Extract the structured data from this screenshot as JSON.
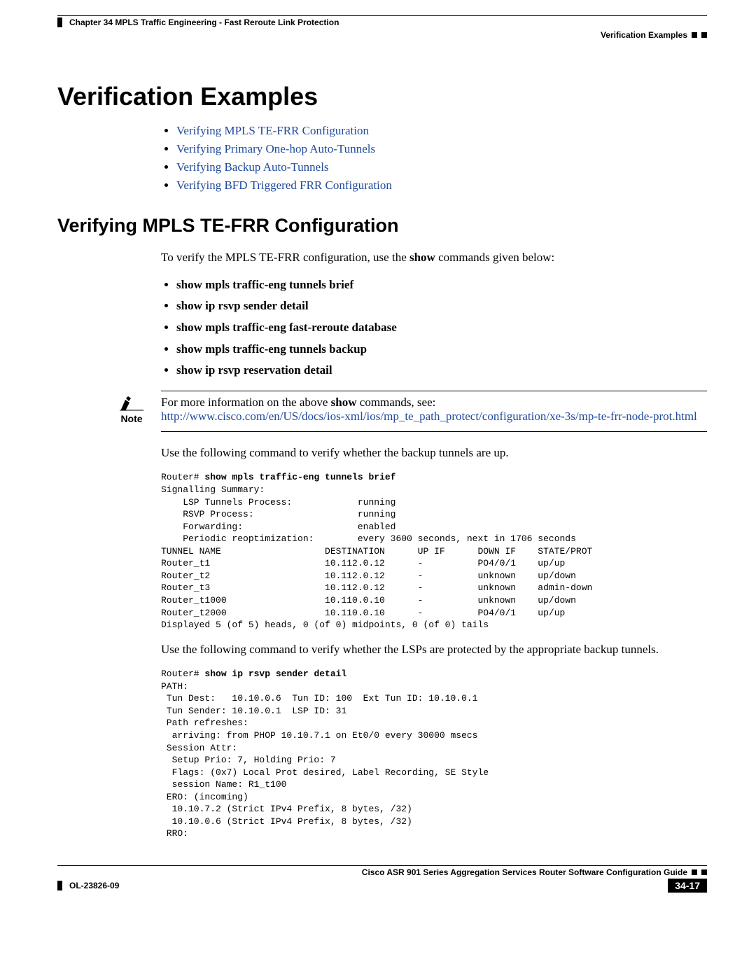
{
  "header": {
    "chapter": "Chapter 34    MPLS Traffic Engineering - Fast Reroute Link Protection",
    "section_right": "Verification Examples"
  },
  "title": "Verification Examples",
  "toc": [
    "Verifying MPLS TE-FRR Configuration",
    "Verifying Primary One-hop Auto-Tunnels",
    "Verifying Backup Auto-Tunnels",
    "Verifying BFD Triggered FRR Configuration"
  ],
  "sub": {
    "heading": "Verifying MPLS TE-FRR Configuration",
    "intro_a": "To verify the MPLS TE-FRR configuration, use the ",
    "intro_bold": "show",
    "intro_b": " commands given below:",
    "cmds": [
      "show mpls traffic-eng tunnels brief",
      "show ip rsvp sender detail",
      "show mpls traffic-eng fast-reroute database",
      "show mpls traffic-eng tunnels backup",
      "show ip rsvp reservation detail"
    ],
    "note_label": "Note",
    "note_a": "For more information on the above ",
    "note_bold": "show",
    "note_b": " commands, see:",
    "note_link": "http://www.cisco.com/en/US/docs/ios-xml/ios/mp_te_path_protect/configuration/xe-3s/mp-te-frr-node-prot.html",
    "para1": "Use the following command to verify whether the backup tunnels are up.",
    "cli1_prompt": "Router# ",
    "cli1_cmd": "show mpls traffic-eng tunnels brief",
    "cli1_body": "\nSignalling Summary:\n    LSP Tunnels Process:            running\n    RSVP Process:                   running\n    Forwarding:                     enabled\n    Periodic reoptimization:        every 3600 seconds, next in 1706 seconds\nTUNNEL NAME                   DESTINATION      UP IF      DOWN IF    STATE/PROT\nRouter_t1                     10.112.0.12      -          PO4/0/1    up/up\nRouter_t2                     10.112.0.12      -          unknown    up/down\nRouter_t3                     10.112.0.12      -          unknown    admin-down\nRouter_t1000                  10.110.0.10      -          unknown    up/down\nRouter_t2000                  10.110.0.10      -          PO4/0/1    up/up\nDisplayed 5 (of 5) heads, 0 (of 0) midpoints, 0 (of 0) tails",
    "para2": "Use the following command to verify whether the LSPs are protected by the appropriate backup tunnels.",
    "cli2_prompt": "Router# ",
    "cli2_cmd": "show ip rsvp sender detail",
    "cli2_body": "\nPATH:\n Tun Dest:   10.10.0.6  Tun ID: 100  Ext Tun ID: 10.10.0.1\n Tun Sender: 10.10.0.1  LSP ID: 31\n Path refreshes:\n  arriving: from PHOP 10.10.7.1 on Et0/0 every 30000 msecs\n Session Attr:\n  Setup Prio: 7, Holding Prio: 7\n  Flags: (0x7) Local Prot desired, Label Recording, SE Style\n  session Name: R1_t100\n ERO: (incoming)\n  10.10.7.2 (Strict IPv4 Prefix, 8 bytes, /32)\n  10.10.0.6 (Strict IPv4 Prefix, 8 bytes, /32)\n RRO:"
  },
  "footer": {
    "guide": "Cisco ASR 901 Series Aggregation Services Router Software Configuration Guide",
    "docid": "OL-23826-09",
    "pagenum": "34-17"
  }
}
